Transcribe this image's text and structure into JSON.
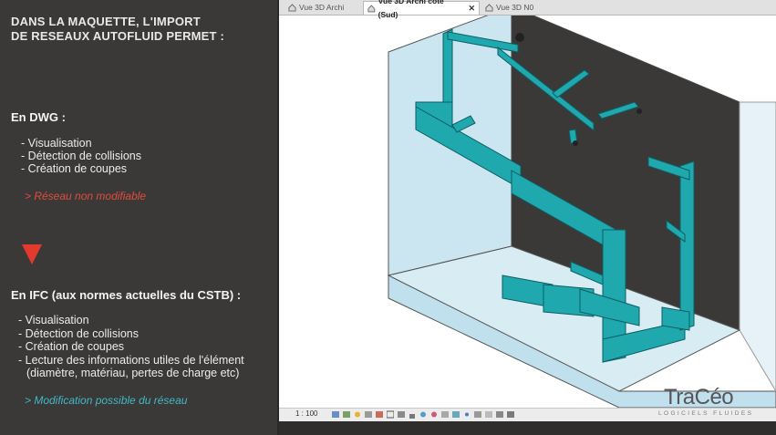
{
  "left_panel": {
    "title_line1": "DANS LA MAQUETTE, L'IMPORT",
    "title_line2": "DE RESEAUX AUTOFLUID PERMET :",
    "dwg": {
      "heading": "En DWG :",
      "items": [
        "- Visualisation",
        "- Détection de collisions",
        "- Création de coupes"
      ],
      "note": "> Réseau non modifiable"
    },
    "ifc": {
      "heading": "En IFC (aux normes actuelles du CSTB) :",
      "items": [
        "- Visualisation",
        "- Détection de collisions",
        "- Création de coupes",
        "- Lecture des informations utiles de l'élément",
        "(diamètre, matériau, pertes de charge etc)"
      ],
      "note": "> Modification possible du réseau"
    },
    "colors": {
      "red": "#e33a2e",
      "blue": "#3fb8c8"
    }
  },
  "viewer": {
    "tabs": [
      {
        "label": "Vue 3D Archi",
        "active": false
      },
      {
        "label": "Vue 3D Archi côté (Sud)",
        "active": true,
        "close": "✕"
      },
      {
        "label": "Vue 3D N0",
        "active": false
      }
    ],
    "status": {
      "scale": "1 : 100"
    },
    "colors": {
      "duct": "#1fa8ae",
      "wall_dark": "#3b3938",
      "glass": "#cbe6f1"
    }
  },
  "logo": {
    "main": "TraCéo",
    "sub": "LOGICIELS FLUIDES"
  }
}
